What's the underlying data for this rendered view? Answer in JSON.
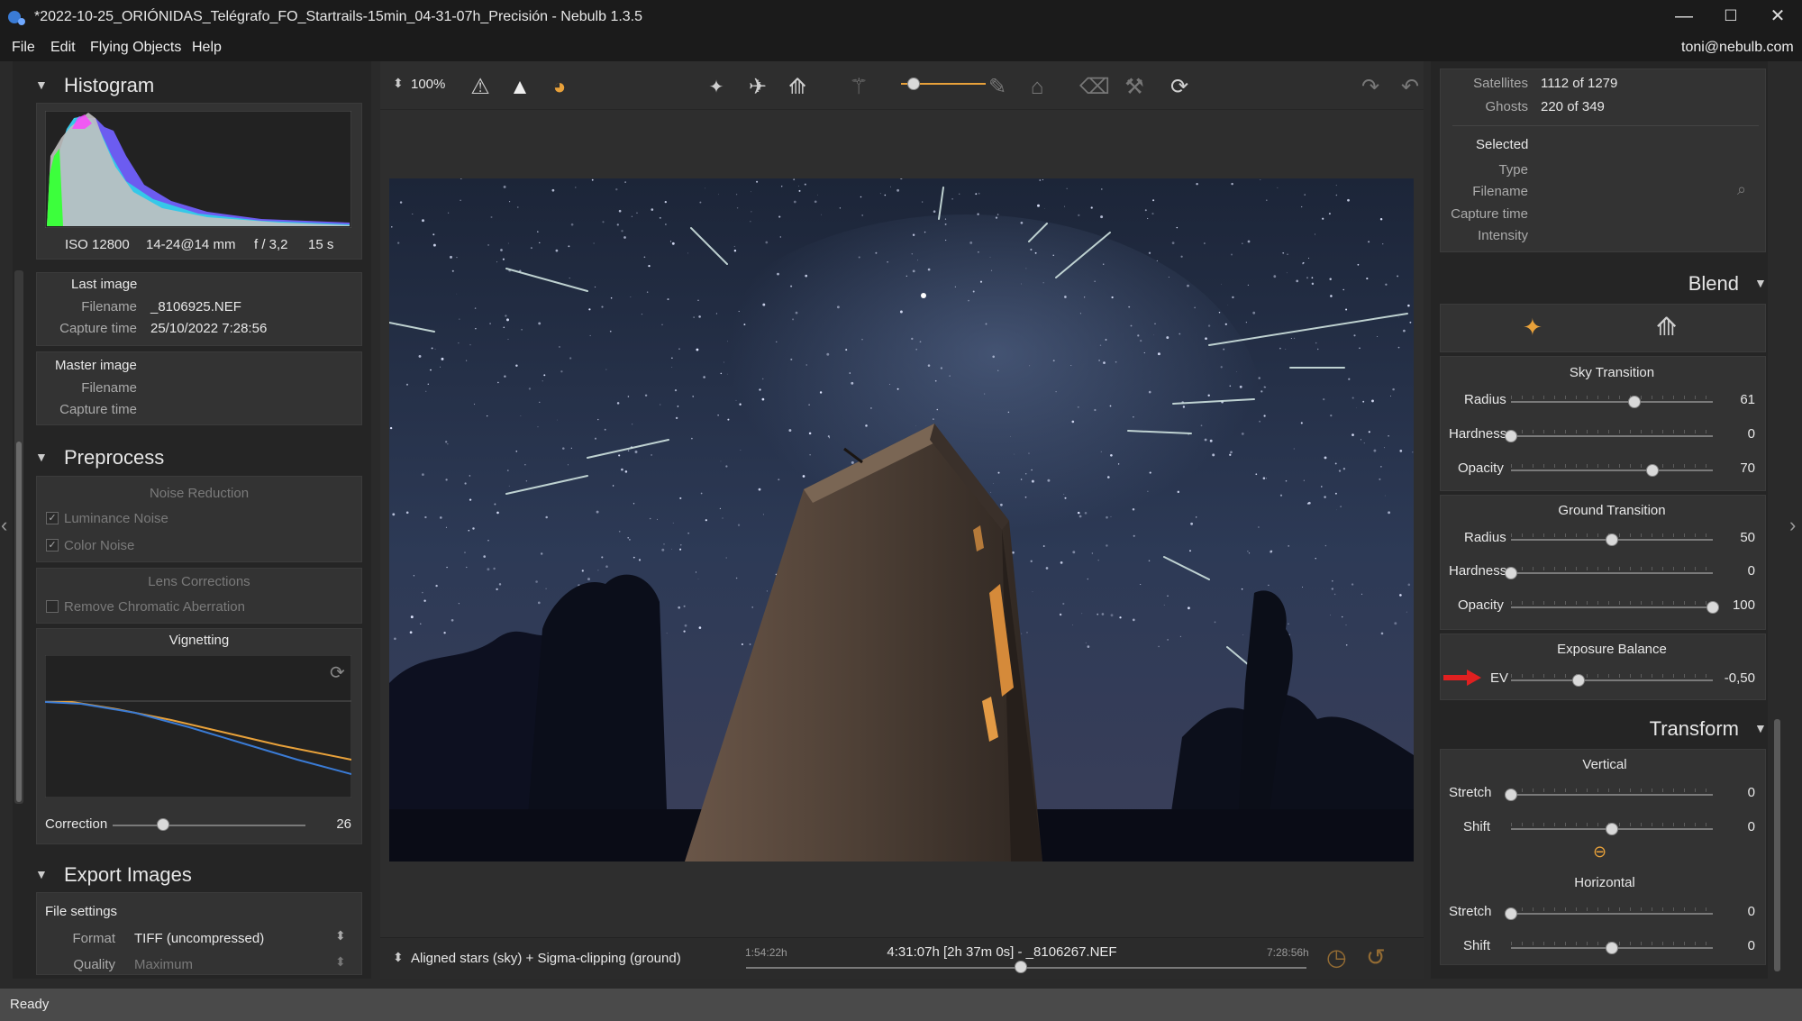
{
  "window": {
    "title": "*2022-10-25_ORIÓNIDAS_Telégrafo_FO_Startrails-15min_04-31-07h_Precisión - Nebulb 1.3.5",
    "minimize": "—",
    "maximize": "☐",
    "close": "✕"
  },
  "menu": {
    "items": [
      "File",
      "Edit",
      "Flying Objects",
      "Help"
    ],
    "user": "toni@nebulb.com"
  },
  "histogram": {
    "title": "Histogram",
    "iso": "ISO 12800",
    "lens": "14-24@14 mm",
    "aperture": "f / 3,2",
    "shutter": "15 s"
  },
  "last_image": {
    "title": "Last image",
    "filename_label": "Filename",
    "filename": "_8106925.NEF",
    "capture_label": "Capture time",
    "capture": "25/10/2022 7:28:56"
  },
  "master_image": {
    "title": "Master image",
    "filename_label": "Filename",
    "capture_label": "Capture time"
  },
  "preprocess": {
    "title": "Preprocess",
    "noise_title": "Noise Reduction",
    "luminance": "Luminance Noise",
    "color": "Color Noise",
    "lens_title": "Lens Corrections",
    "chromatic": "Remove Chromatic Aberration",
    "vignetting": "Vignetting",
    "correction_label": "Correction",
    "correction_value": "26",
    "correction_level": 0.26
  },
  "export": {
    "title": "Export Images",
    "file_settings": "File settings",
    "format_label": "Format",
    "format_value": "TIFF (uncompressed)",
    "quality_label": "Quality",
    "quality_value": "Maximum"
  },
  "toolbar": {
    "zoom": "100%"
  },
  "bottom": {
    "mode": "Aligned stars (sky) + Sigma-clipping (ground)",
    "start": "1:54:22h",
    "current": "4:31:07h [2h 37m 0s] - _8106267.NEF",
    "end": "7:28:56h",
    "timeline_position": 0.49
  },
  "info": {
    "satellites_label": "Satellites",
    "satellites_value": "1112 of 1279",
    "ghosts_label": "Ghosts",
    "ghosts_value": "220 of 349",
    "selected_title": "Selected",
    "type_label": "Type",
    "filename_label": "Filename",
    "capture_label": "Capture time",
    "intensity_label": "Intensity"
  },
  "blend": {
    "title": "Blend",
    "sky_title": "Sky Transition",
    "ground_title": "Ground Transition",
    "exposure_title": "Exposure Balance",
    "radius_label": "Radius",
    "hardness_label": "Hardness",
    "opacity_label": "Opacity",
    "ev_label": "EV",
    "sky_radius": "61",
    "sky_hardness": "0",
    "sky_opacity": "70",
    "ground_radius": "50",
    "ground_hardness": "0",
    "ground_opacity": "100",
    "ev_value": "-0,50"
  },
  "transform": {
    "title": "Transform",
    "vertical_title": "Vertical",
    "horizontal_title": "Horizontal",
    "stretch_label": "Stretch",
    "shift_label": "Shift",
    "v_stretch": "0",
    "v_shift": "0",
    "h_stretch": "0",
    "h_shift": "0"
  },
  "status": {
    "text": "Ready"
  },
  "colors": {
    "accent": "#e8a13a",
    "arrow": "#e02020"
  }
}
